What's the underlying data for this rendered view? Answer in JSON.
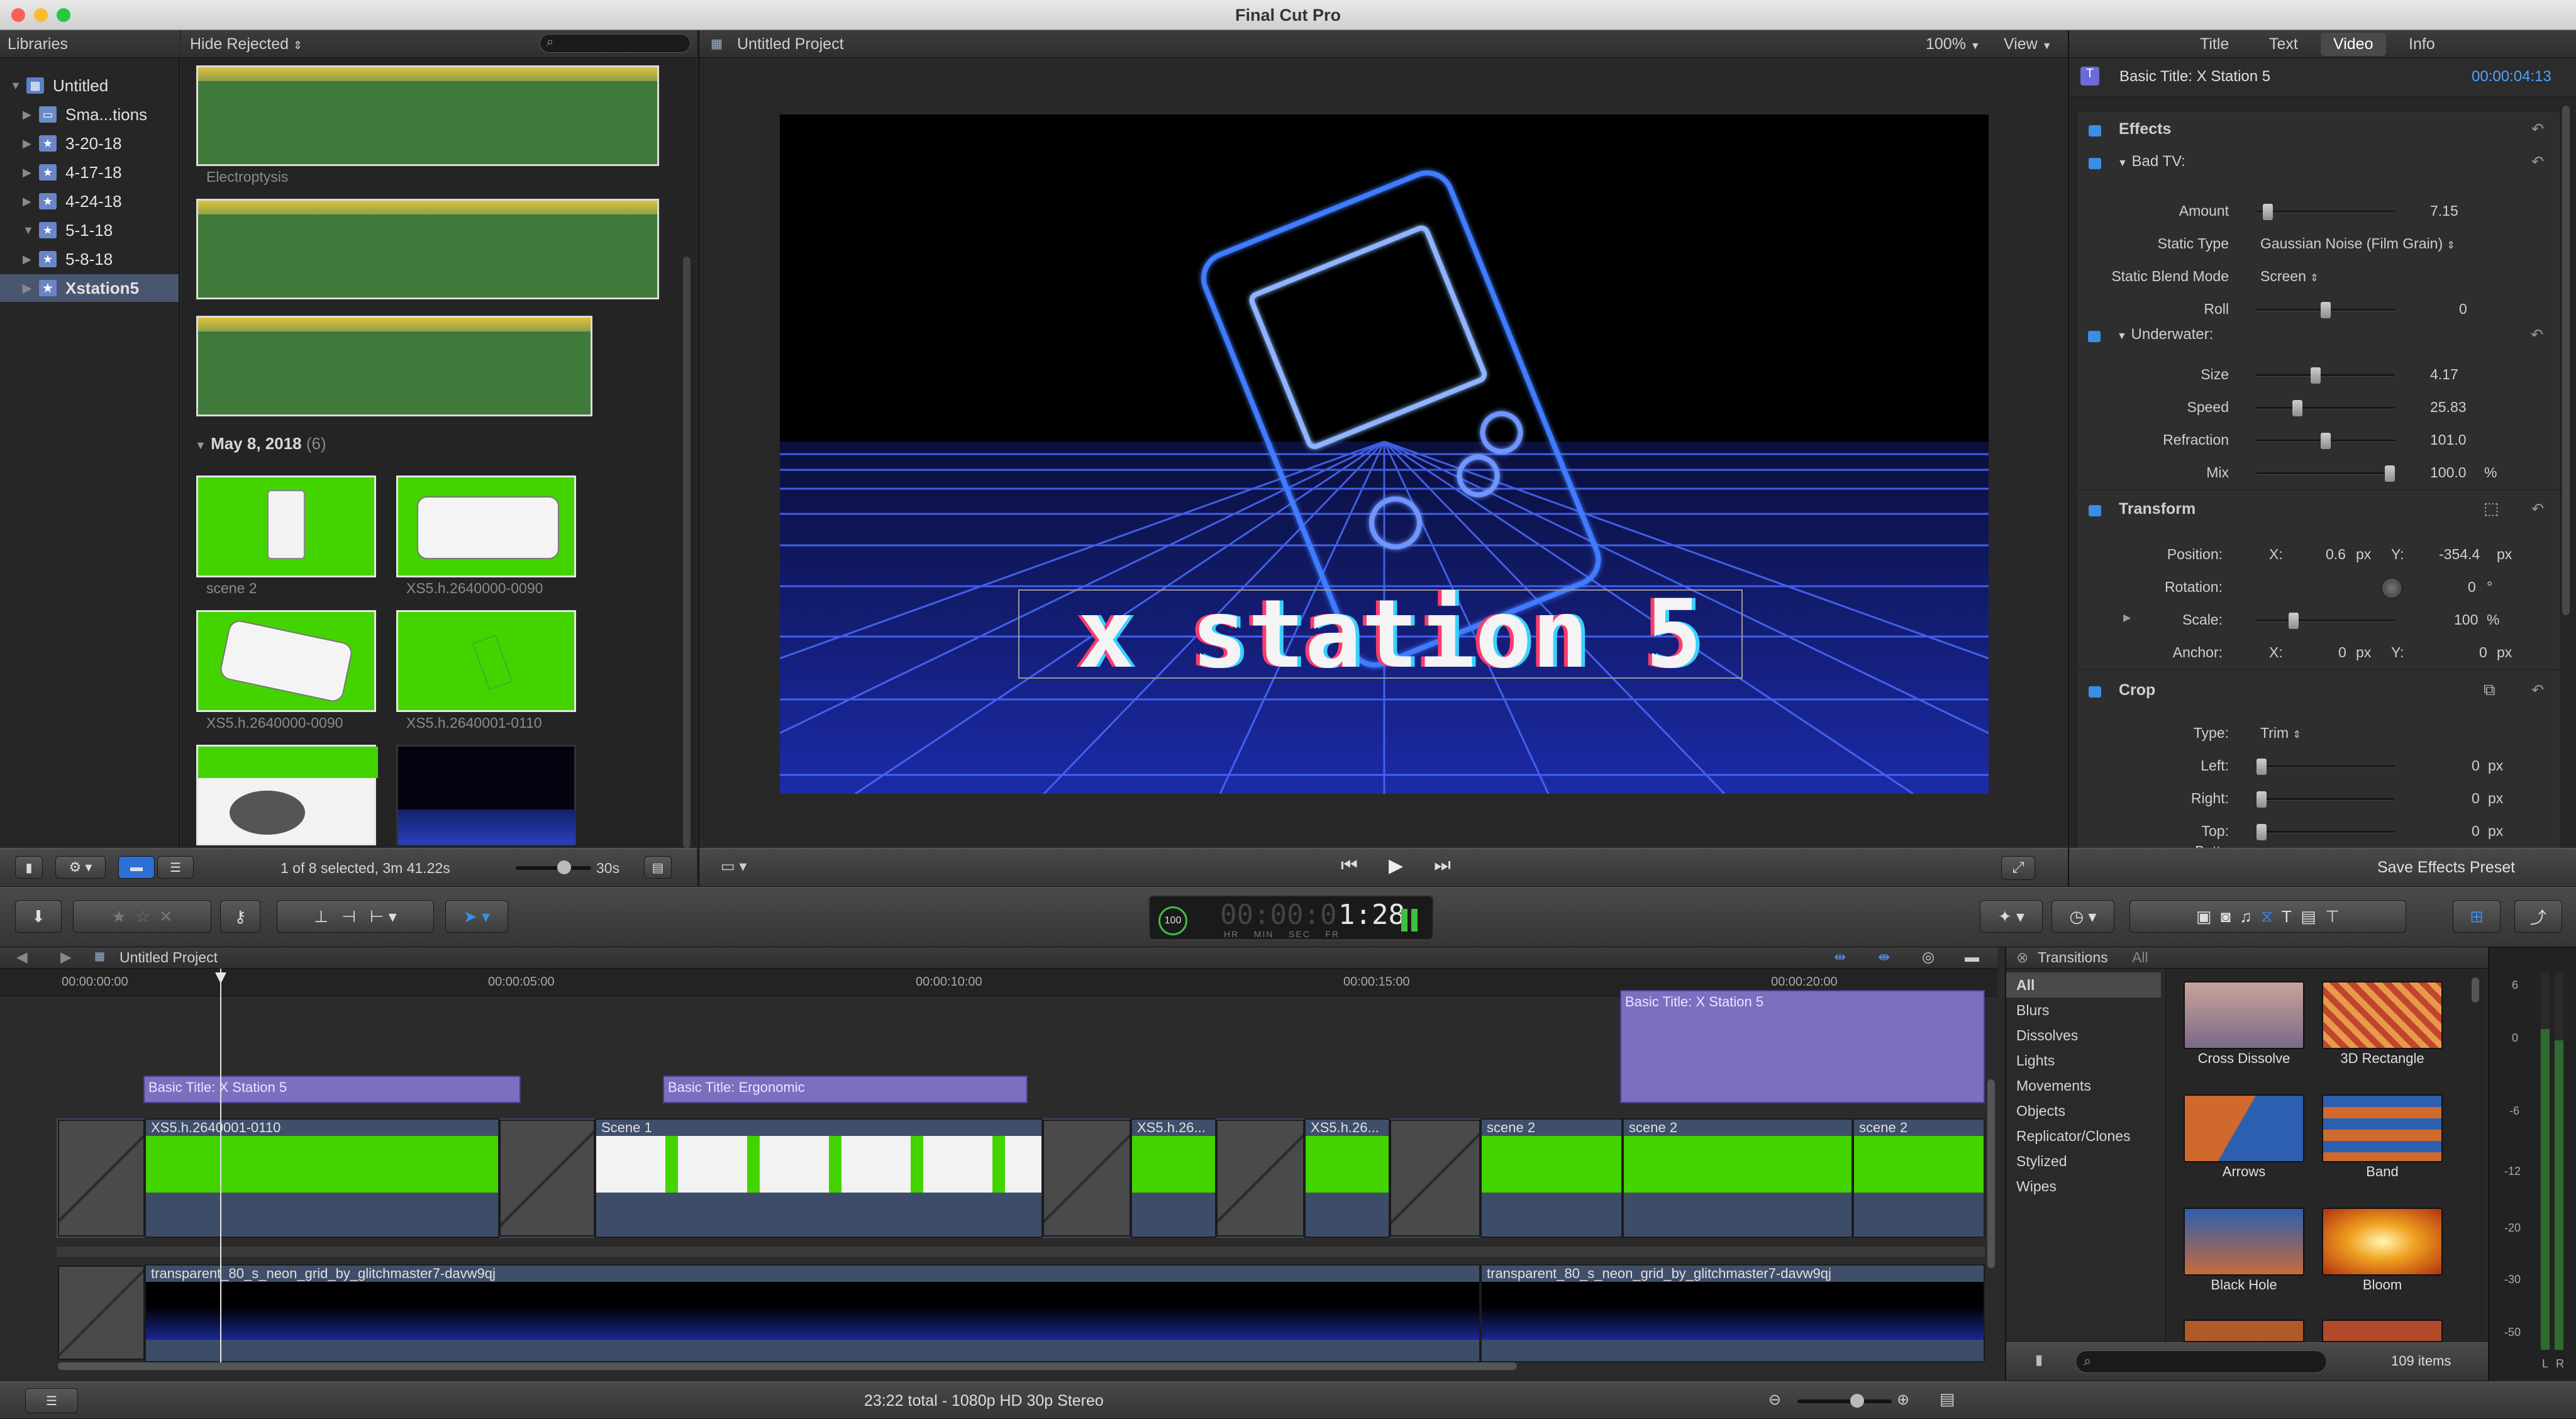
{
  "app": {
    "title": "Final Cut Pro"
  },
  "browser": {
    "libraries_label": "Libraries",
    "filter_label": "Hide Rejected",
    "library_items": [
      {
        "label": "Untitled"
      },
      {
        "label": "Sma...tions"
      },
      {
        "label": "3-20-18"
      },
      {
        "label": "4-17-18"
      },
      {
        "label": "4-24-18"
      },
      {
        "label": "5-1-18"
      },
      {
        "label": "5-8-18"
      },
      {
        "label": "Xstation5"
      }
    ],
    "audio_clip_label": "Electroptysis",
    "date_group": {
      "label": "May 8, 2018",
      "count": "(6)"
    },
    "clips": [
      {
        "label": "scene 2"
      },
      {
        "label": "XS5.h.2640000-0090"
      },
      {
        "label": "XS5.h.2640000-0090"
      },
      {
        "label": "XS5.h.2640001-0110"
      }
    ],
    "status": "1 of 8 selected, 3m 41.22s",
    "duration": "30s"
  },
  "viewer": {
    "title": "Untitled Project",
    "zoom": "100%",
    "view_label": "View",
    "overlay_text": "x station 5"
  },
  "inspector": {
    "tabs": [
      "Title",
      "Text",
      "Video",
      "Info"
    ],
    "clip_title": "Basic Title: X Station 5",
    "clip_time": "00:00:04:13",
    "effects_label": "Effects",
    "bad_tv": {
      "label": "Bad TV:",
      "amount_label": "Amount",
      "amount": "7.15",
      "amount_frac": 0.05,
      "static_type_label": "Static Type",
      "static_type": "Gaussian Noise (Film Grain)",
      "static_blend_label": "Static Blend Mode",
      "static_blend": "Screen",
      "roll_label": "Roll",
      "roll": "0",
      "roll_frac": 0.5
    },
    "underwater": {
      "label": "Underwater:",
      "size_label": "Size",
      "size": "4.17",
      "size_frac": 0.42,
      "speed_label": "Speed",
      "speed": "25.83",
      "speed_frac": 0.28,
      "refraction_label": "Refraction",
      "refraction": "101.0",
      "refraction_frac": 0.5,
      "mix_label": "Mix",
      "mix": "100.0",
      "mix_unit": "%",
      "mix_frac": 1.0
    },
    "transform": {
      "label": "Transform",
      "position_label": "Position:",
      "x_label": "X:",
      "pos_x": "0.6",
      "y_label": "Y:",
      "pos_y": "-354.4",
      "unit_px": "px",
      "rotation_label": "Rotation:",
      "rotation": "0",
      "deg": "°",
      "scale_label": "Scale:",
      "scale": "100",
      "scale_unit": "%",
      "scale_frac": 0.25,
      "anchor_label": "Anchor:",
      "anchor_x": "0",
      "anchor_y": "0"
    },
    "crop": {
      "label": "Crop",
      "type_label": "Type:",
      "type": "Trim",
      "left_label": "Left:",
      "left": "0",
      "right_label": "Right:",
      "right": "0",
      "top_label": "Top:",
      "top": "0",
      "bottom_label": "Bottom:",
      "unit": "px"
    },
    "save_preset": "Save Effects Preset"
  },
  "timecode": {
    "value": "1:28",
    "zeros": "00:00:0",
    "labels": [
      "HR",
      "MIN",
      "SEC",
      "FR"
    ],
    "percent": "100"
  },
  "timeline": {
    "project_title": "Untitled Project",
    "ruler": [
      "00:00:00:00",
      "00:00:05:00",
      "00:00:10:00",
      "00:00:15:00",
      "00:00:20:00"
    ],
    "title_clips": [
      {
        "label": "Basic Title: X Station 5"
      },
      {
        "label": "Basic Title: Ergonomic"
      },
      {
        "label": "Basic Title: X Station 5"
      }
    ],
    "video_clips": [
      {
        "label": "XS5.h.2640001-0110"
      },
      {
        "label": "Scene 1"
      },
      {
        "label": "XS5.h.26..."
      },
      {
        "label": "XS5.h.26..."
      },
      {
        "label": "scene 2"
      },
      {
        "label": "scene 2"
      },
      {
        "label": "scene 2"
      }
    ],
    "bg_clips": [
      {
        "label": "transparent_80_s_neon_grid_by_glitchmaster7-davw9qj"
      },
      {
        "label": "transparent_80_s_neon_grid_by_glitchmaster7-davw9qj"
      }
    ],
    "status": "23:22 total - 1080p HD 30p Stereo"
  },
  "transitions": {
    "title": "Transitions",
    "scope": "All",
    "categories": [
      "All",
      "Blurs",
      "Dissolves",
      "Lights",
      "Movements",
      "Objects",
      "Replicator/Clones",
      "Stylized",
      "Wipes"
    ],
    "items": [
      {
        "label": "Cross Dissolve"
      },
      {
        "label": "3D Rectangle"
      },
      {
        "label": "Arrows"
      },
      {
        "label": "Band"
      },
      {
        "label": "Black Hole"
      },
      {
        "label": "Bloom"
      }
    ],
    "count": "109 items"
  },
  "meters": {
    "scale": [
      "6",
      "0",
      "-6",
      "-12",
      "-20",
      "-30",
      "-50"
    ],
    "channels": [
      "L",
      "R"
    ]
  }
}
